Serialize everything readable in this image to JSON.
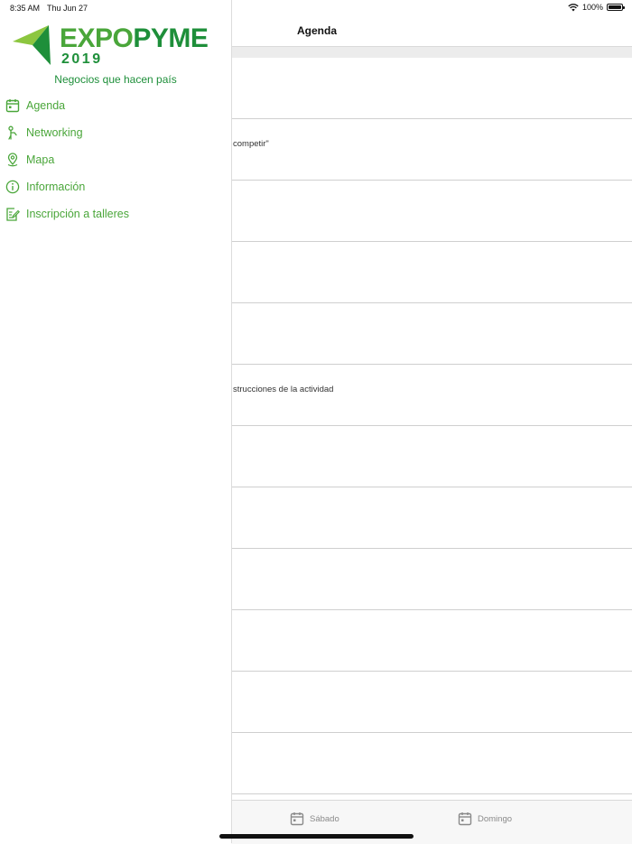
{
  "status_bar": {
    "time": "8:35 AM",
    "date": "Thu Jun 27",
    "battery": "100%"
  },
  "logo": {
    "word_a": "EXPO",
    "word_b": "PYME",
    "year": "2019"
  },
  "tagline": "Negocios que hacen país",
  "menu": [
    {
      "label": "Agenda",
      "icon": "calendar-icon"
    },
    {
      "label": "Networking",
      "icon": "person-icon"
    },
    {
      "label": "Mapa",
      "icon": "map-pin-icon"
    },
    {
      "label": "Información",
      "icon": "info-icon"
    },
    {
      "label": "Inscripción a talleres",
      "icon": "edit-document-icon"
    }
  ],
  "header": {
    "title": "Agenda"
  },
  "rows": [
    "",
    "competir\"",
    "",
    "",
    "",
    "strucciones de la actividad",
    "",
    "",
    "",
    "",
    "",
    ""
  ],
  "tabs": [
    {
      "label": "Sábado",
      "icon": "calendar-icon"
    },
    {
      "label": "Domingo",
      "icon": "calendar-icon"
    }
  ],
  "colors": {
    "brand_green": "#4aa63a",
    "dark_green": "#1e8f3a",
    "lime": "#8cc63f"
  }
}
